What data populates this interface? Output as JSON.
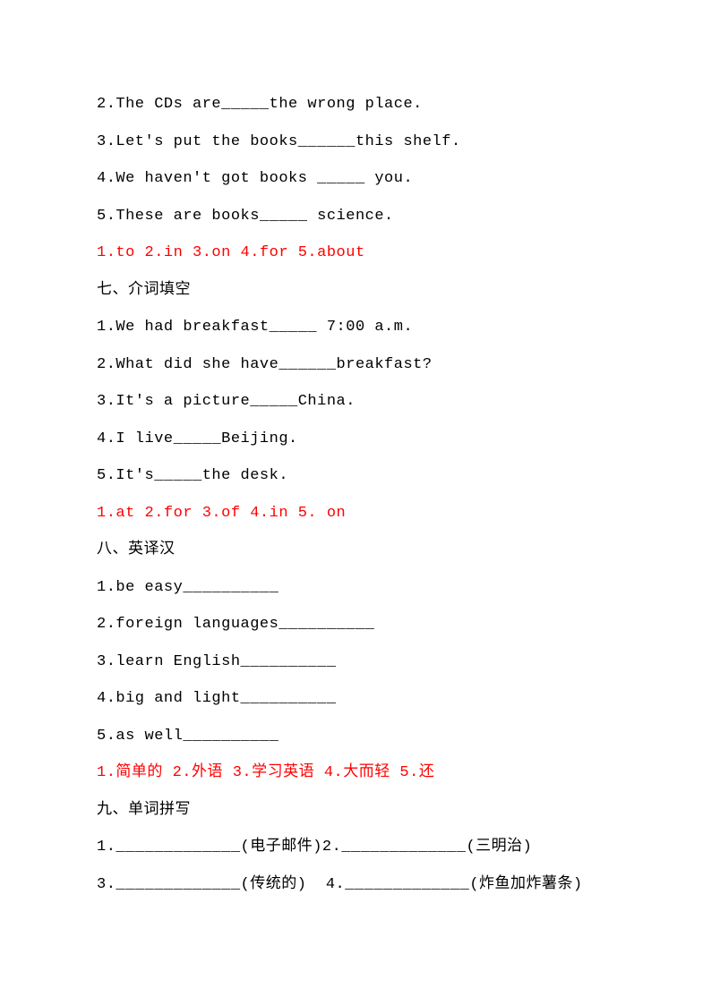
{
  "lines": [
    {
      "text": "2.The CDs are_____the wrong place.",
      "red": false
    },
    {
      "text": "3.Let's put the books______this shelf.",
      "red": false
    },
    {
      "text": "4.We haven't got books _____ you.",
      "red": false
    },
    {
      "text": "5.These are books_____ science.",
      "red": false
    },
    {
      "text": "1.to 2.in 3.on 4.for 5.about",
      "red": true
    },
    {
      "text": "七、介词填空",
      "red": false
    },
    {
      "text": "1.We had breakfast_____ 7:00 a.m.",
      "red": false
    },
    {
      "text": "2.What did she have______breakfast?",
      "red": false
    },
    {
      "text": "3.It's a picture_____China.",
      "red": false
    },
    {
      "text": "4.I live_____Beijing.",
      "red": false
    },
    {
      "text": "5.It's_____the desk.",
      "red": false
    },
    {
      "text": "1.at 2.for 3.of 4.in 5. on",
      "red": true
    },
    {
      "text": "八、英译汉",
      "red": false
    },
    {
      "text": "1.be easy__________",
      "red": false
    },
    {
      "text": "2.foreign languages__________",
      "red": false
    },
    {
      "text": "3.learn English__________",
      "red": false
    },
    {
      "text": "4.big and light__________",
      "red": false
    },
    {
      "text": "5.as well__________",
      "red": false
    },
    {
      "text": "1.简单的 2.外语 3.学习英语 4.大而轻 5.还",
      "red": true
    },
    {
      "text": "九、单词拼写",
      "red": false
    },
    {
      "text": "1._____________(电子邮件)2._____________(三明治)",
      "red": false
    },
    {
      "text": "3._____________(传统的)  4._____________(炸鱼加炸薯条)",
      "red": false
    }
  ]
}
